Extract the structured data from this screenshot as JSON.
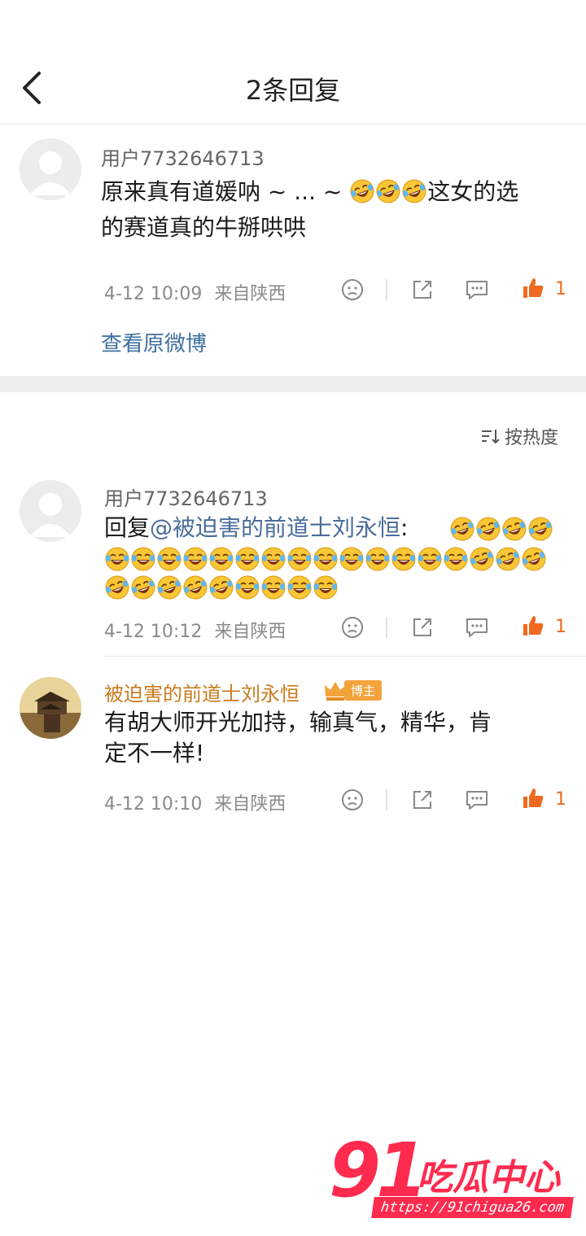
{
  "header": {
    "title": "2条回复",
    "back_icon": "back-arrow-icon"
  },
  "root_comment": {
    "user": "用户7732646713",
    "text_pre": "原来真有道媛呐 ~ ... ~ ",
    "emoji_icon": "laugh-cry-emoji",
    "emoji_count": 3,
    "text_post": "这女的选",
    "text_line2": "的赛道真的牛掰哄哄",
    "time": "4-12 10:09",
    "location": "来自陕西",
    "likes": "1"
  },
  "view_original": "查看原微博",
  "sort_label": "按热度",
  "replies": [
    {
      "user": "用户7732646713",
      "reply_prefix": "回复",
      "mention": "@被迫害的前道士刘永恒",
      "colon": ":",
      "time": "4-12 10:12",
      "location": "来自陕西",
      "likes": "1"
    },
    {
      "user": "被迫害的前道士刘永恒",
      "badge": "博主",
      "text_line1": "有胡大师开光加持，输真气，精华，肯",
      "text_line2": "定不一样!",
      "time": "4-12 10:10",
      "location": "来自陕西",
      "likes": "1"
    }
  ],
  "watermark": {
    "num": "91",
    "brand": "吃瓜中心",
    "url": "https://91chigua26.com"
  },
  "colors": {
    "accent_link": "#3e6fa0",
    "like": "#ee6a1f",
    "blogger_name": "#c97b1d",
    "watermark": "#ff2b4f"
  }
}
